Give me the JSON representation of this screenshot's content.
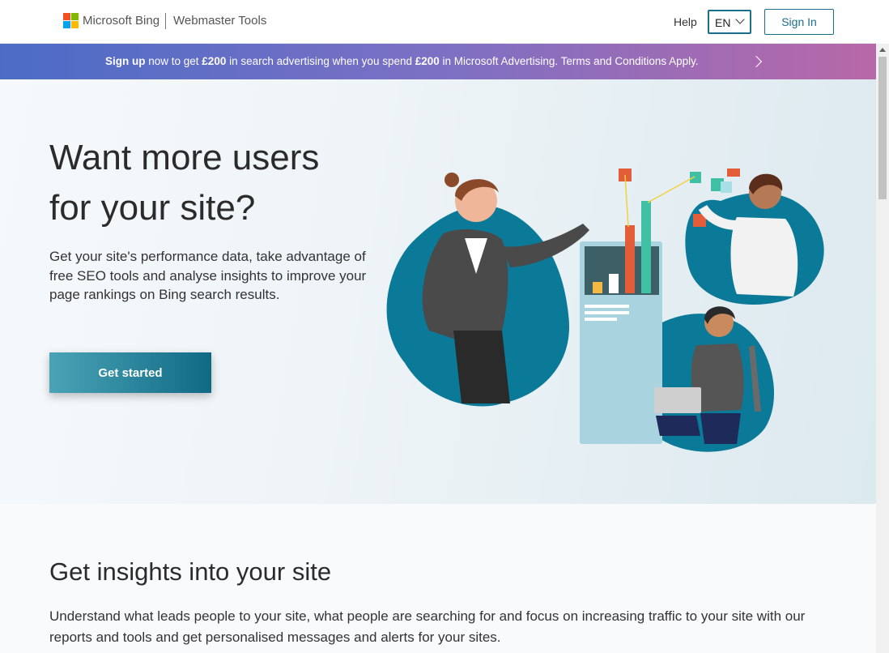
{
  "header": {
    "brand": "Microsoft Bing",
    "product": "Webmaster Tools",
    "help_label": "Help",
    "language": "EN",
    "signin_label": "Sign In"
  },
  "promo": {
    "sign_up": "Sign up",
    "text_1": " now to get ",
    "amount_1": "£200",
    "text_2": " in search advertising when you spend ",
    "amount_2": "£200",
    "text_3": " in Microsoft Advertising.   Terms and Conditions Apply."
  },
  "hero": {
    "title_line1": "Want more users",
    "title_line2": "for your site?",
    "subtitle": "Get your site's performance data, take advantage of free SEO tools and analyse insights to improve your page rankings on Bing search results.",
    "cta_label": "Get started"
  },
  "insights": {
    "title": "Get insights into your site",
    "text": "Understand what leads people to your site, what people are searching for and focus on increasing traffic to your site with our reports and tools and get personalised messages and alerts for your sites."
  },
  "colors": {
    "accent": "#1a6f8c",
    "teal_blob": "#0b7a99",
    "promo_start": "#4b6cc6",
    "promo_end": "#b868a8"
  },
  "icons": {
    "logo": "microsoft-logo-icon",
    "dropdown": "chevron-down-icon",
    "promo_arrow": "chevron-right-icon"
  }
}
